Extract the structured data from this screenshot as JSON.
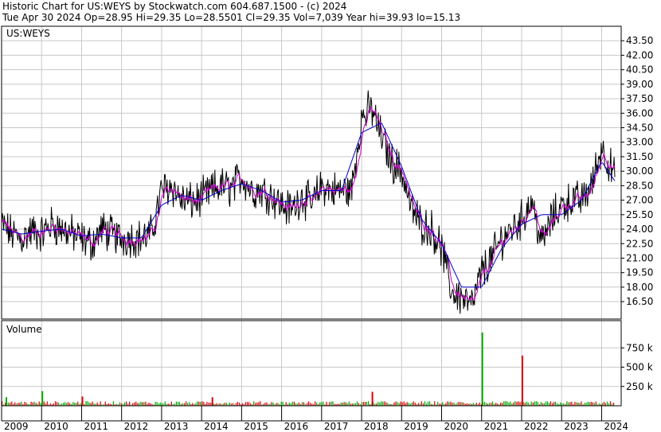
{
  "header": {
    "line1": "Historic Chart for US:WEYS by Stockwatch.com 604.687.1500 - (c) 2024",
    "line2": "Tue Apr 30 2024   Op=28.95   Hi=29.35   Lo=28.5501   Cl=29.35   Vol=7,039   Year hi=39.93   lo=15.13"
  },
  "chart_data": [
    {
      "type": "line",
      "title": "US:WEYS",
      "y_ticks": [
        "43.50",
        "42.00",
        "40.50",
        "39.00",
        "37.50",
        "36.00",
        "34.50",
        "33.00",
        "31.50",
        "30.00",
        "28.50",
        "27.00",
        "25.50",
        "24.00",
        "22.50",
        "21.00",
        "19.50",
        "18.00",
        "16.50"
      ],
      "ylim": [
        14.7,
        45.0
      ],
      "x_ticks": [
        "2009",
        "2010",
        "2011",
        "2012",
        "2013",
        "2014",
        "2015",
        "2016",
        "2017",
        "2018",
        "2019",
        "2020",
        "2021",
        "2022",
        "2023",
        "2024"
      ],
      "grid": true,
      "series": [
        {
          "color": "#000000",
          "x": [
            2009.0,
            2009.25,
            2009.5,
            2009.75,
            2010.0,
            2010.25,
            2010.5,
            2010.75,
            2011.0,
            2011.25,
            2011.5,
            2011.75,
            2012.0,
            2012.25,
            2012.5,
            2012.75,
            2013.0,
            2013.25,
            2013.5,
            2013.75,
            2014.0,
            2014.25,
            2014.5,
            2014.75,
            2015.0,
            2015.25,
            2015.5,
            2015.75,
            2016.0,
            2016.25,
            2016.5,
            2016.75,
            2017.0,
            2017.25,
            2017.5,
            2017.75,
            2018.0,
            2018.25,
            2018.5,
            2018.75,
            2019.0,
            2019.25,
            2019.5,
            2019.75,
            2020.0,
            2020.25,
            2020.5,
            2020.75,
            2021.0,
            2021.25,
            2021.5,
            2021.75,
            2022.0,
            2022.25,
            2022.5,
            2022.75,
            2023.0,
            2023.25,
            2023.5,
            2023.75,
            2024.0,
            2024.33
          ],
          "y": [
            24.5,
            23.5,
            23.0,
            23.8,
            23.5,
            24.5,
            24.0,
            23.5,
            23.0,
            22.5,
            24.0,
            23.5,
            23.0,
            23.2,
            23.0,
            23.5,
            28.0,
            28.5,
            27.0,
            26.8,
            27.2,
            28.0,
            28.5,
            28.2,
            29.5,
            28.0,
            28.0,
            27.5,
            26.5,
            26.0,
            27.5,
            26.5,
            28.5,
            28.0,
            28.0,
            28.0,
            35.5,
            36.5,
            33.5,
            31.0,
            30.0,
            26.0,
            24.5,
            24.0,
            22.0,
            17.5,
            17.0,
            16.0,
            19.5,
            21.0,
            23.0,
            24.0,
            25.0,
            27.0,
            22.5,
            25.0,
            26.5,
            27.0,
            27.0,
            28.5,
            32.5,
            29.35
          ]
        },
        {
          "color": "#0000cc",
          "x": [
            2009.0,
            2009.5,
            2010.0,
            2010.5,
            2011.0,
            2011.5,
            2012.0,
            2012.5,
            2013.0,
            2013.5,
            2014.0,
            2014.5,
            2015.0,
            2015.5,
            2016.0,
            2016.5,
            2017.0,
            2017.5,
            2018.0,
            2018.5,
            2019.0,
            2019.5,
            2020.0,
            2020.5,
            2021.0,
            2021.5,
            2022.0,
            2022.5,
            2023.0,
            2023.5,
            2024.0,
            2024.33
          ],
          "y": [
            24.0,
            23.5,
            23.8,
            24.0,
            23.3,
            23.5,
            23.1,
            23.1,
            26.5,
            27.5,
            27.0,
            28.0,
            28.7,
            28.0,
            26.8,
            27.0,
            28.0,
            28.0,
            34.0,
            35.0,
            30.5,
            25.0,
            22.5,
            18.0,
            18.0,
            22.0,
            24.5,
            25.5,
            25.5,
            27.0,
            31.0,
            29.0
          ]
        }
      ]
    },
    {
      "type": "bar",
      "title": "Volume",
      "y_ticks": [
        "750 k",
        "500 k",
        "250 k"
      ],
      "ylim": [
        0,
        1000000
      ],
      "note_peaks": [
        {
          "x": 2021.0,
          "value": 950000,
          "color": "#00aa00"
        },
        {
          "x": 2022.0,
          "value": 650000,
          "color": "#dd0000"
        },
        {
          "x": 2009.1,
          "value": 110000,
          "color": "#00aa00"
        },
        {
          "x": 2010.0,
          "value": 190000,
          "color": "#00aa00"
        },
        {
          "x": 2011.0,
          "value": 120000,
          "color": "#dd0000"
        },
        {
          "x": 2014.25,
          "value": 110000,
          "color": "#dd0000"
        },
        {
          "x": 2018.25,
          "value": 180000,
          "color": "#dd0000"
        }
      ]
    }
  ]
}
